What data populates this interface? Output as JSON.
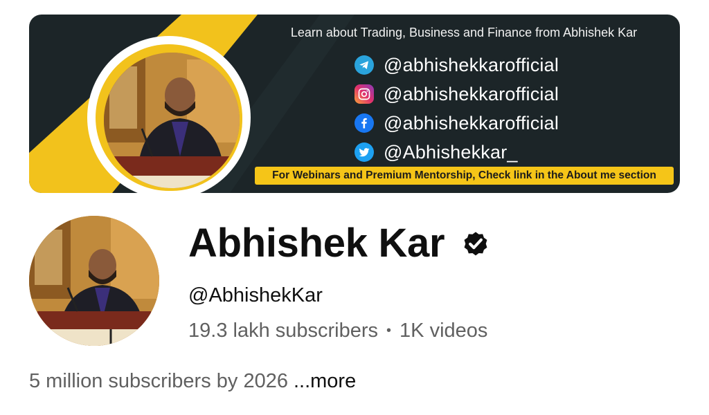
{
  "banner": {
    "tagline": "Learn about Trading, Business and Finance from Abhishek Kar",
    "socials": [
      {
        "icon": "telegram-icon",
        "handle": "@abhishekkarofficial",
        "color": "#2aa3dc"
      },
      {
        "icon": "instagram-icon",
        "handle": "@abhishekkarofficial",
        "color": "#d6247a"
      },
      {
        "icon": "facebook-icon",
        "handle": "@abhishekkarofficial",
        "color": "#1877f2"
      },
      {
        "icon": "twitter-icon",
        "handle": "@Abhishekkar_",
        "color": "#1da1f2"
      }
    ],
    "cta": "For Webinars and Premium Mentorship, Check link in the About me section",
    "accent_color": "#f5c518",
    "background_color": "#1c2528"
  },
  "channel": {
    "name": "Abhishek Kar",
    "verified_icon": "verified-check-icon",
    "handle": "@AbhishekKar",
    "subscribers": "19.3 lakh subscribers",
    "separator": "•",
    "videos": "1K videos",
    "description": "5 million subscribers by 2026",
    "more_label": "...more"
  }
}
